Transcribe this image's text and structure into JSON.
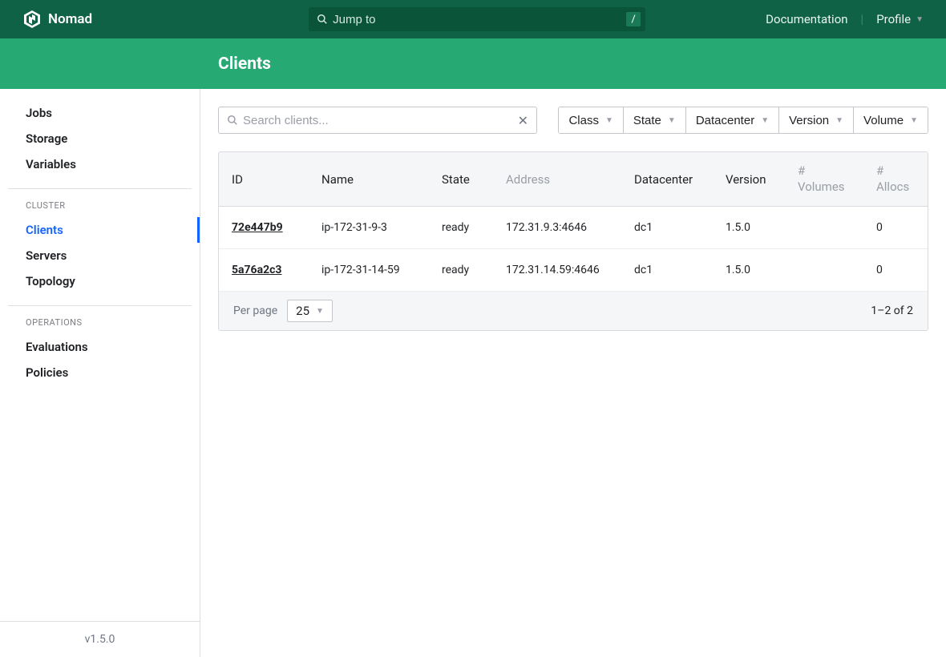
{
  "brand": "Nomad",
  "jump": {
    "placeholder": "Jump to",
    "key": "/"
  },
  "topnav": {
    "docs": "Documentation",
    "profile": "Profile"
  },
  "pageTitle": "Clients",
  "sidebar": {
    "primary": [
      {
        "label": "Jobs"
      },
      {
        "label": "Storage"
      },
      {
        "label": "Variables"
      }
    ],
    "clusterHeading": "CLUSTER",
    "cluster": [
      {
        "label": "Clients",
        "active": true
      },
      {
        "label": "Servers"
      },
      {
        "label": "Topology"
      }
    ],
    "opsHeading": "OPERATIONS",
    "ops": [
      {
        "label": "Evaluations"
      },
      {
        "label": "Policies"
      }
    ],
    "version": "v1.5.0"
  },
  "search": {
    "placeholder": "Search clients..."
  },
  "filters": [
    {
      "label": "Class"
    },
    {
      "label": "State"
    },
    {
      "label": "Datacenter"
    },
    {
      "label": "Version"
    },
    {
      "label": "Volume"
    }
  ],
  "columns": {
    "id": "ID",
    "name": "Name",
    "state": "State",
    "address": "Address",
    "datacenter": "Datacenter",
    "version": "Version",
    "volumesPrefix": "#",
    "volumes": "Volumes",
    "allocsPrefix": "#",
    "allocs": "Allocs"
  },
  "rows": [
    {
      "id": "72e447b9",
      "name": "ip-172-31-9-3",
      "state": "ready",
      "address": "172.31.9.3:4646",
      "datacenter": "dc1",
      "version": "1.5.0",
      "volumes": "",
      "allocs": "0"
    },
    {
      "id": "5a76a2c3",
      "name": "ip-172-31-14-59",
      "state": "ready",
      "address": "172.31.14.59:4646",
      "datacenter": "dc1",
      "version": "1.5.0",
      "volumes": "",
      "allocs": "0"
    }
  ],
  "pagination": {
    "perPageLabel": "Per page",
    "perPageValue": "25",
    "info": "1–2 of 2"
  }
}
